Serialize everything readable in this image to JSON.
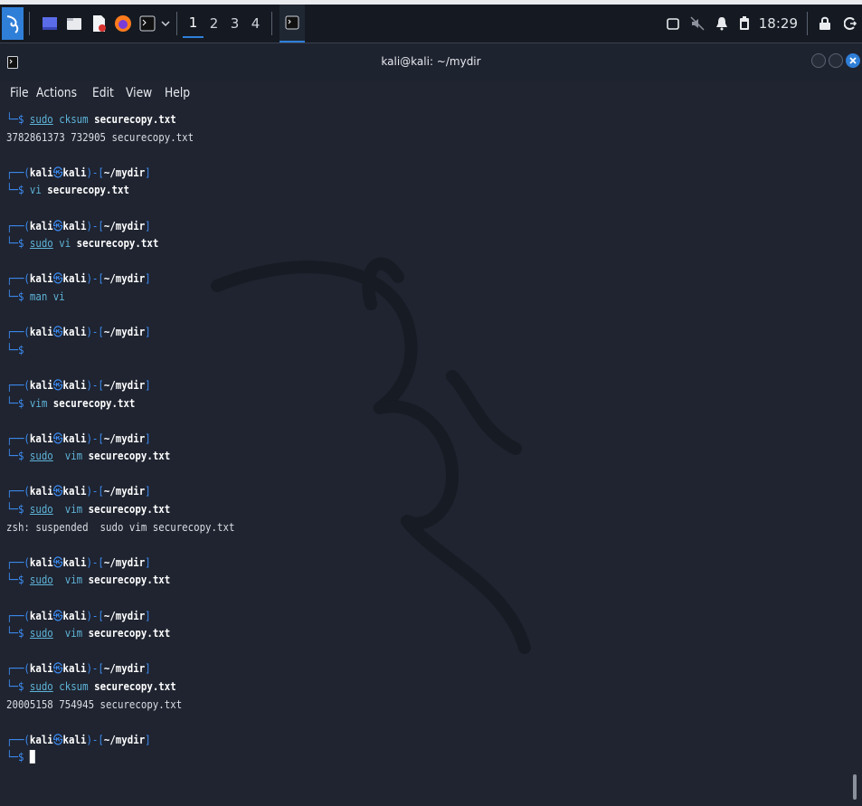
{
  "taskbar": {
    "workspaces": [
      "1",
      "2",
      "3",
      "4"
    ],
    "active_workspace": "1",
    "clock": "18:29",
    "accent": "#2f7fd8"
  },
  "window": {
    "title": "kali@kali: ~/mydir"
  },
  "menu": [
    "File",
    "Actions",
    "Edit",
    "View",
    "Help"
  ],
  "terminal": {
    "user": "kali",
    "host": "kali",
    "dir": "~/mydir",
    "entries": [
      {
        "cmd_parts": [
          "sudo",
          " cksum ",
          "securecopy.txt"
        ],
        "output": "3782861373 732905 securecopy.txt",
        "prompt_top": false
      },
      {
        "cmd_parts": [
          "",
          "vi ",
          "securecopy.txt"
        ],
        "output": ""
      },
      {
        "cmd_parts": [
          "sudo",
          " vi ",
          "securecopy.txt"
        ],
        "output": ""
      },
      {
        "cmd_parts": [
          "",
          "man vi",
          ""
        ],
        "output": ""
      },
      {
        "cmd_parts": [
          "",
          "",
          ""
        ],
        "output": ""
      },
      {
        "cmd_parts": [
          "",
          "vim ",
          "securecopy.txt"
        ],
        "output": ""
      },
      {
        "cmd_parts": [
          "sudo",
          "  vim ",
          "securecopy.txt"
        ],
        "output": ""
      },
      {
        "cmd_parts": [
          "sudo",
          "  vim ",
          "securecopy.txt"
        ],
        "output": "zsh: suspended  sudo vim securecopy.txt"
      },
      {
        "cmd_parts": [
          "sudo",
          "  vim ",
          "securecopy.txt"
        ],
        "output": ""
      },
      {
        "cmd_parts": [
          "sudo",
          "  vim ",
          "securecopy.txt"
        ],
        "output": ""
      },
      {
        "cmd_parts": [
          "sudo",
          " cksum ",
          "securecopy.txt"
        ],
        "output": "20005158 754945 securecopy.txt"
      },
      {
        "cmd_parts": [
          "",
          "",
          ""
        ],
        "output": "",
        "cursor": true
      }
    ]
  }
}
